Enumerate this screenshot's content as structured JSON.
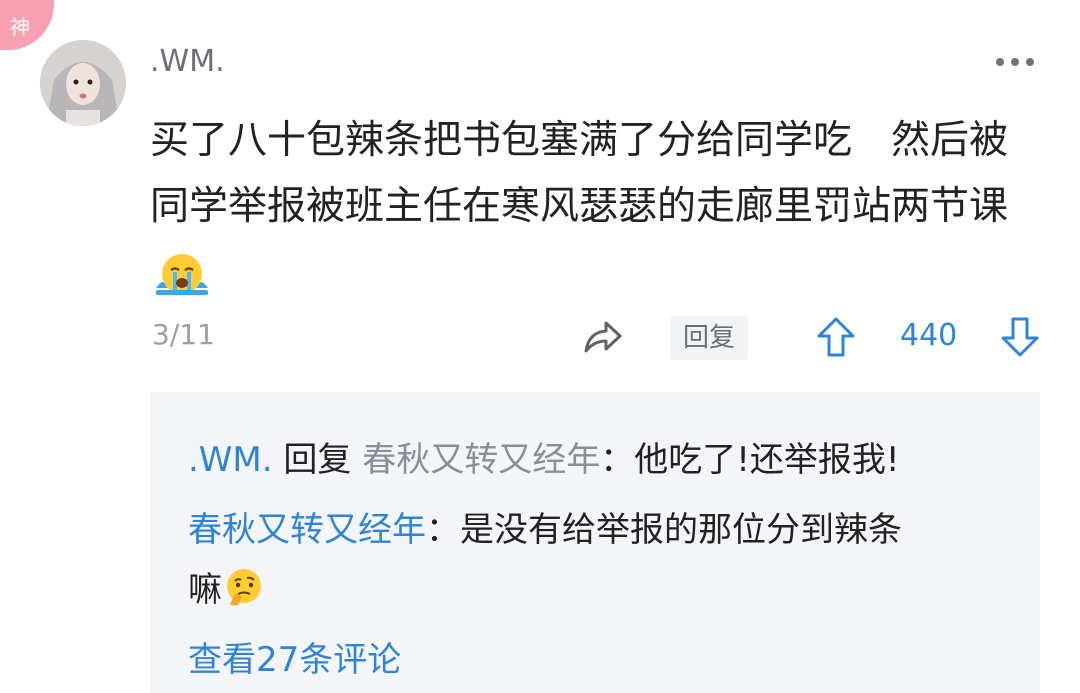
{
  "badge": {
    "label": "神"
  },
  "comment": {
    "username": ".WM.",
    "text_line1": "买了八十包辣条把书包塞满了分给同学吃　然后被",
    "text_line2": "同学举报被班主任在寒风瑟瑟的走廊里罚站两节课",
    "date": "3/11",
    "reply_label": "回复",
    "like_count": "440"
  },
  "replies": {
    "r1": {
      "author": ".WM.",
      "verb": "回复",
      "target": "春秋又转又经年",
      "sep": "：",
      "text": "他吃了!还举报我!"
    },
    "r2": {
      "author": "春秋又转又经年",
      "sep": "：",
      "text_line1": "是没有给举报的那位分到辣条",
      "text_line2": "嘛"
    },
    "view_all": "查看27条评论"
  },
  "icons": {
    "emoji1": "crying-face-icon",
    "emoji2": "thinking-face-icon",
    "share": "share-arrow-icon",
    "like": "thumb-up-arrow-icon",
    "dislike": "thumb-down-arrow-icon",
    "more": "more-dots-icon"
  },
  "colors": {
    "accent": "#2f84d8",
    "badge": "#f7a0b2",
    "reply_bg": "#f3f5f8",
    "meta_text": "#9aa0a8"
  }
}
